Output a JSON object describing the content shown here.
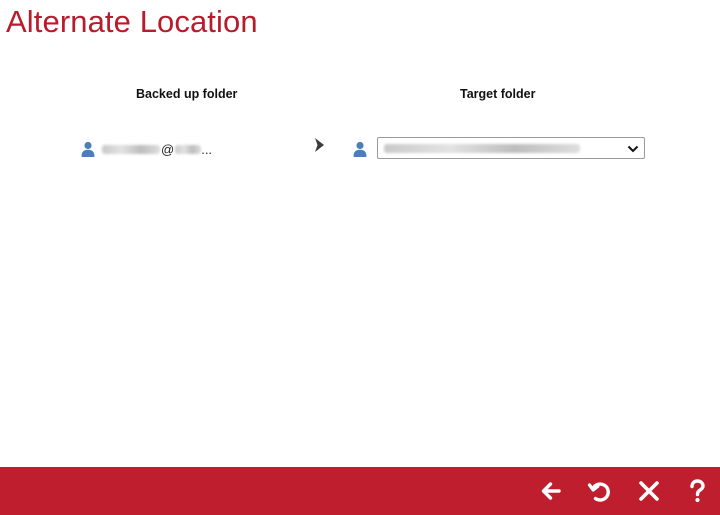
{
  "page": {
    "title": "Alternate Location"
  },
  "columns": {
    "backed_up_label": "Backed up folder",
    "target_label": "Target folder"
  },
  "source": {
    "at_symbol": "@",
    "ellipsis": "..."
  },
  "icons": {
    "user": "user-icon",
    "arrow": "chevron-right-icon",
    "back": "arrow-left-icon",
    "restore": "restore-icon",
    "close": "close-icon",
    "help": "help-icon"
  },
  "colors": {
    "accent": "#be1e2d",
    "title": "#b81c2c",
    "user_icon": "#4a80b5"
  }
}
